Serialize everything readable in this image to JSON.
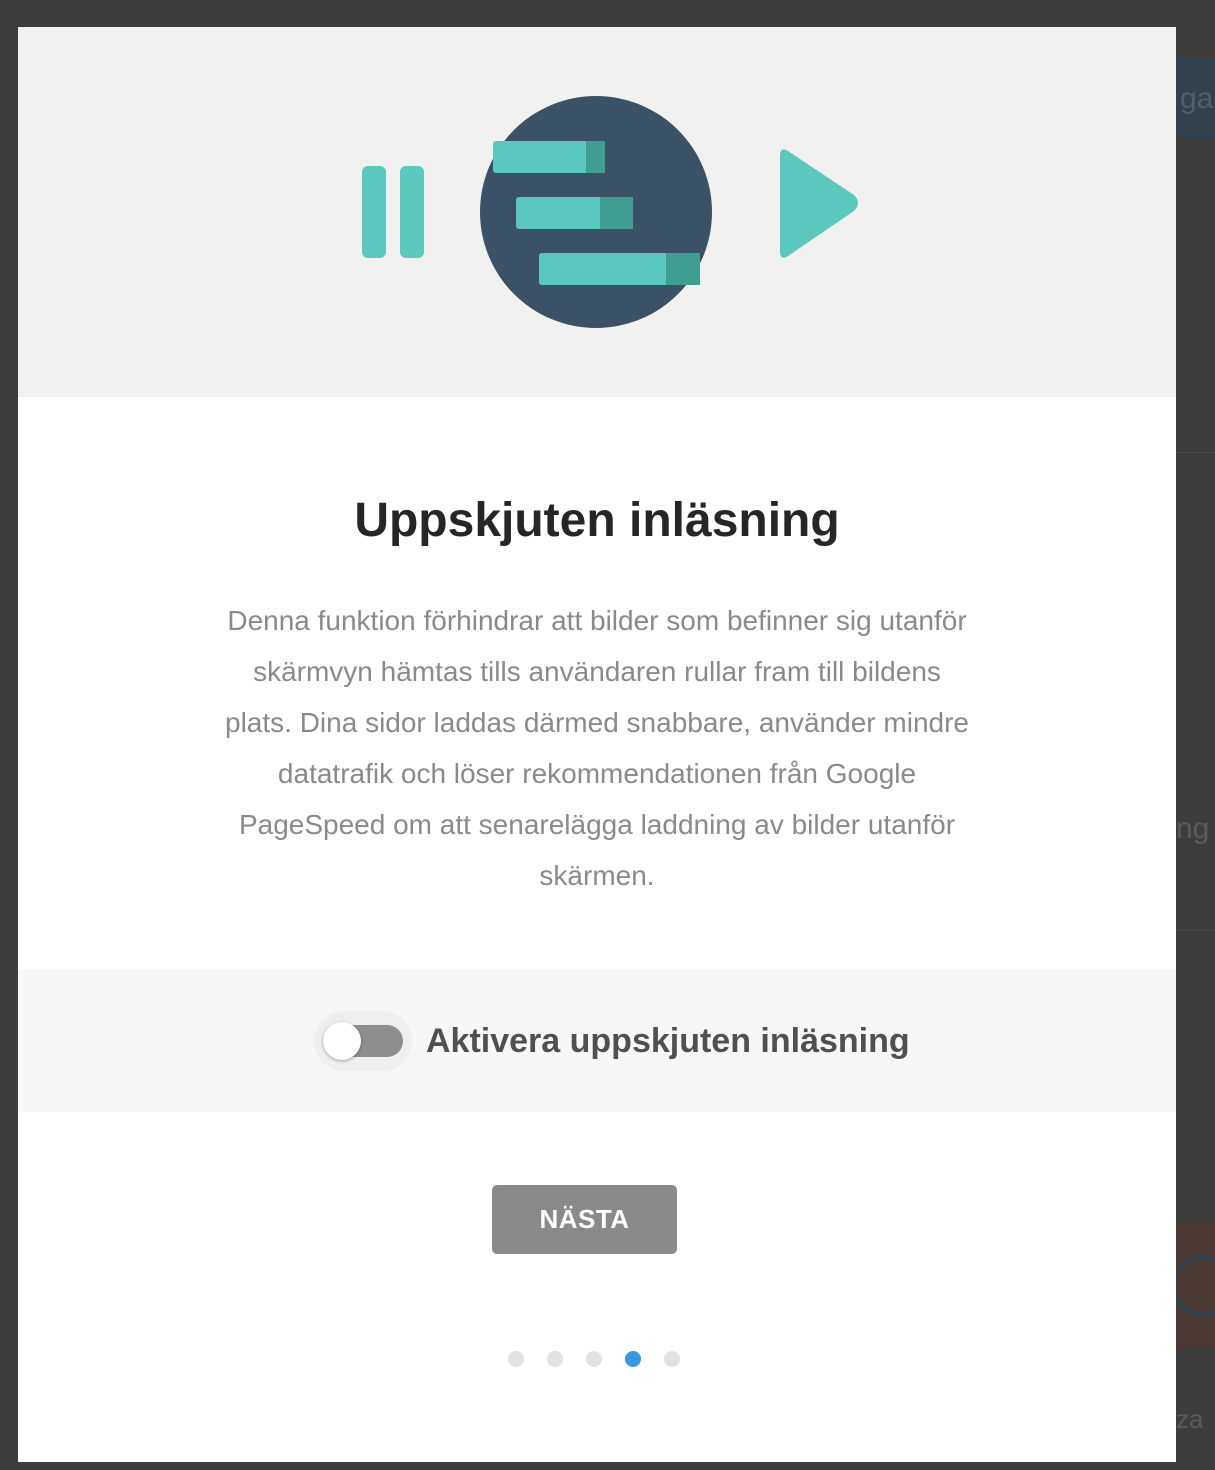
{
  "background": {
    "text_1": "ga",
    "text_2": "ng",
    "text_3": "za"
  },
  "modal": {
    "hero": {
      "icons": [
        "pause-icon",
        "lazy-load-icon",
        "play-icon"
      ],
      "colors": {
        "background": "#f1f1f1",
        "teal": "#5bc8bd",
        "teal_dark": "#3f9e8f",
        "circle": "#3a5166"
      }
    },
    "title": "Uppskjuten inläsning",
    "description": "Denna funktion förhindrar att bilder som befinner sig utanför skärmvyn hämtas tills användaren rullar fram till bildens plats. Dina sidor laddas därmed snabbare, använder mindre datatrafik och löser rekommendationen från Google PageSpeed om att senarelägga laddning av bilder utanför skärmen.",
    "toggle": {
      "label": "Aktivera uppskjuten inläsning",
      "checked": false
    },
    "next_button": "NÄSTA",
    "pagination": {
      "total": 5,
      "current": 4,
      "active_color": "#3a97e0"
    }
  }
}
